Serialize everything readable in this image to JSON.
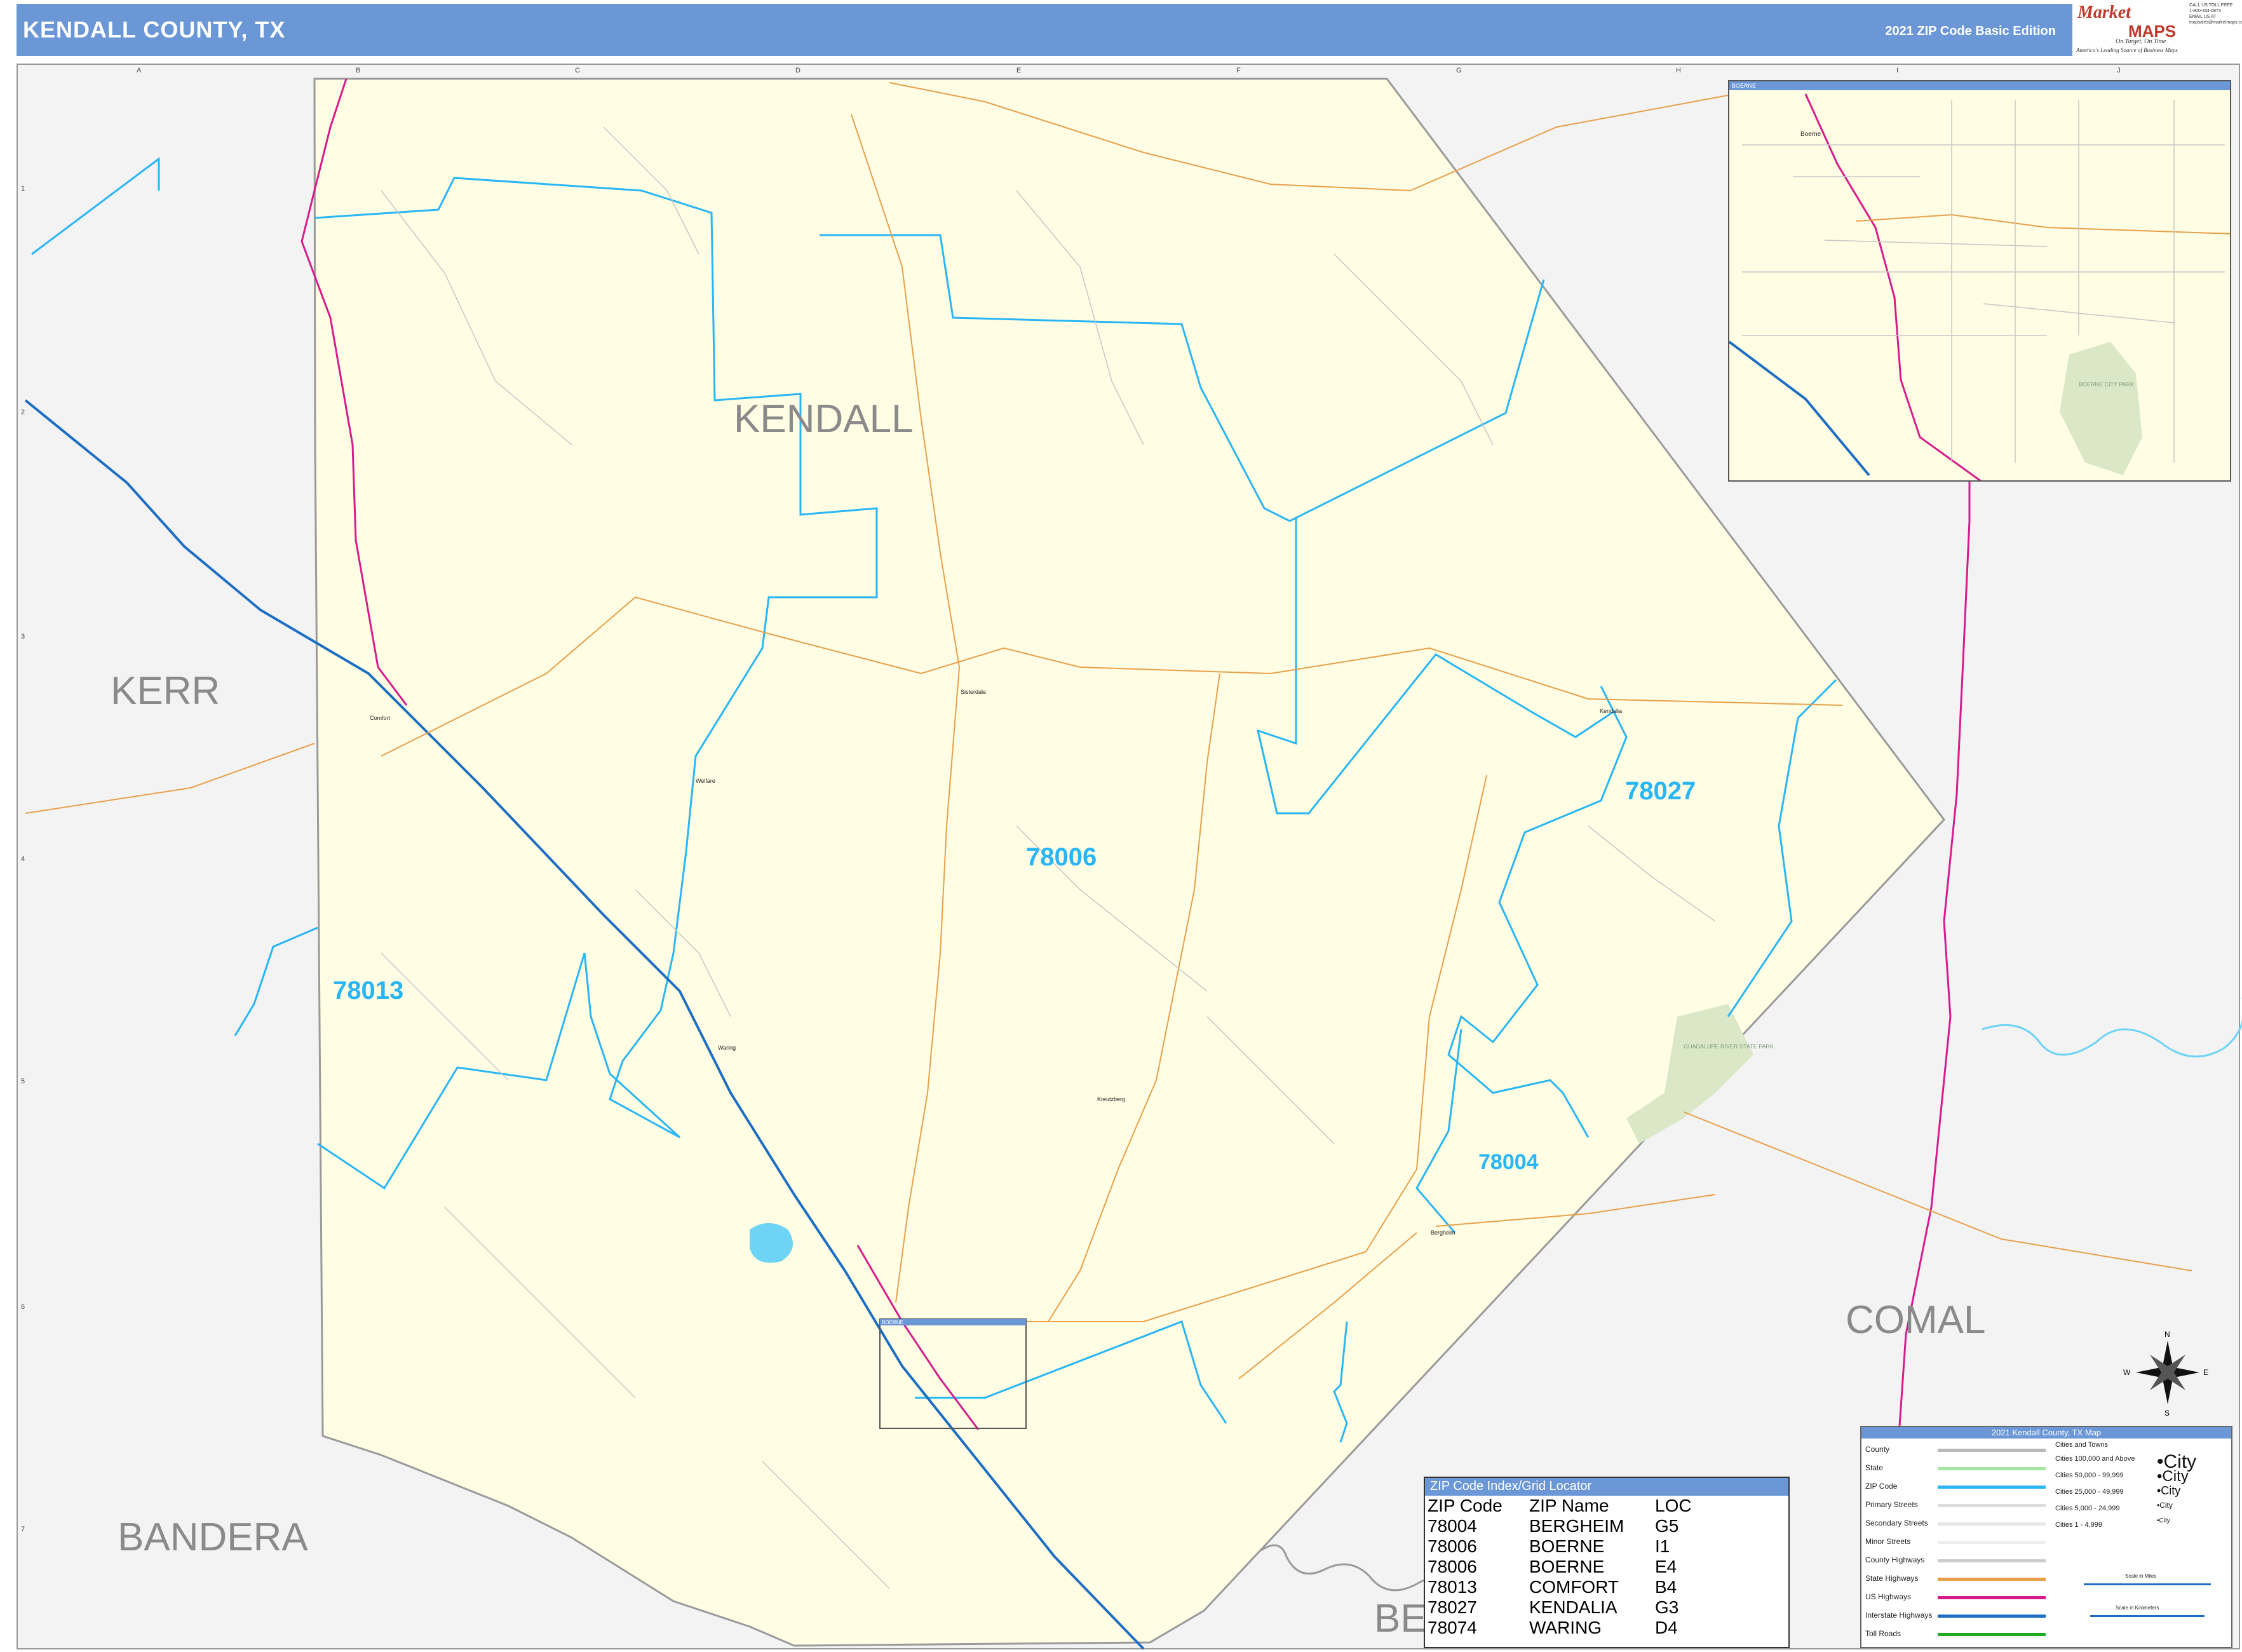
{
  "header": {
    "title": "KENDALL COUNTY, TX",
    "edition": "2021 ZIP Code Basic Edition"
  },
  "logo": {
    "brand_top": "Market",
    "brand_bottom": "MAPS",
    "tagline": "On Target, On Time",
    "subtagline": "America's Leading Source of Business Maps"
  },
  "contact": {
    "line1": "CALL US TOLL FREE",
    "line2": "1-800-334-6873",
    "line3": "EMAIL US AT",
    "line4": "mapsales@marketmaps.com"
  },
  "grid": {
    "columns": [
      "A",
      "B",
      "C",
      "D",
      "E",
      "F",
      "G",
      "H",
      "I",
      "J"
    ],
    "rows": [
      "1",
      "2",
      "3",
      "4",
      "5",
      "6",
      "7"
    ]
  },
  "map": {
    "counties": {
      "kendall": "KENDALL",
      "kerr": "KERR",
      "comal": "COMAL",
      "bandera": "BANDERA",
      "bexar_partial": "BE"
    },
    "zips": {
      "z78006": "78006",
      "z78013": "78013",
      "z78027": "78027",
      "z78004": "78004"
    },
    "towns": {
      "comfort": "Comfort",
      "waring": "Waring",
      "sisterdale": "Sisterdale",
      "kendalia": "Kendalia",
      "welfare": "Welfare",
      "kreutzberg": "Kreutzberg",
      "bergheim": "Bergheim",
      "boerne": "Boerne"
    },
    "park": "GUADALUPE RIVER STATE PARK",
    "compass": {
      "n": "N",
      "s": "S",
      "e": "E",
      "w": "W"
    }
  },
  "inset": {
    "header": "BOERNE",
    "town": "Boerne",
    "park": "BOERNE CITY PARK"
  },
  "inset_marker_label": "BOERNE",
  "zip_index": {
    "title": "ZIP Code Index/Grid Locator",
    "columns": [
      "ZIP Code",
      "ZIP Name",
      "LOC"
    ],
    "rows": [
      [
        "78004",
        "BERGHEIM",
        "G5"
      ],
      [
        "78006",
        "BOERNE",
        "I1"
      ],
      [
        "78006",
        "BOERNE",
        "E4"
      ],
      [
        "78013",
        "COMFORT",
        "B4"
      ],
      [
        "78027",
        "KENDALIA",
        "G3"
      ],
      [
        "78074",
        "WARING",
        "D4"
      ]
    ]
  },
  "legend": {
    "title": "2021 Kendall County, TX Map",
    "items": [
      {
        "label": "County",
        "color": "#b9b9b9"
      },
      {
        "label": "State",
        "color": "#a5e6a5"
      },
      {
        "label": "ZIP Code",
        "color": "#29b6f6"
      },
      {
        "label": "Primary Streets",
        "color": "#dddddd"
      },
      {
        "label": "Secondary Streets",
        "color": "#e6e6e6"
      },
      {
        "label": "Minor Streets",
        "color": "#eeeeee"
      },
      {
        "label": "County Highways",
        "color": "#cccccc"
      },
      {
        "label": "State Highways",
        "color": "#e8a04a"
      },
      {
        "label": "US Highways",
        "color": "#d81b8c"
      },
      {
        "label": "Interstate Highways",
        "color": "#1e6fc4"
      },
      {
        "label": "Toll Roads",
        "color": "#22aa22"
      }
    ],
    "cities_heading": "Cities and Towns",
    "cities": [
      {
        "label": "Cities 100,000 and Above",
        "sample": "•City"
      },
      {
        "label": "Cities 50,000 - 99,999",
        "sample": "•City"
      },
      {
        "label": "Cities 25,000 - 49,999",
        "sample": "•City"
      },
      {
        "label": "Cities 5,000 - 24,999",
        "sample": "•City"
      },
      {
        "label": "Cities 1 - 4,999",
        "sample": "•City"
      }
    ],
    "scale_miles": "Scale in Miles",
    "scale_km": "Scale in Kilometers"
  },
  "colors": {
    "header_bg": "#6b97d6",
    "county_fill": "#fffde3",
    "outside_fill": "#f3f3f3",
    "zip_line": "#29b6f6",
    "state_hwy": "#e8a04a",
    "us_hwy": "#d81b8c",
    "interstate": "#1e6fc4",
    "water": "#6fd3f5",
    "park": "#dbe8c8"
  }
}
